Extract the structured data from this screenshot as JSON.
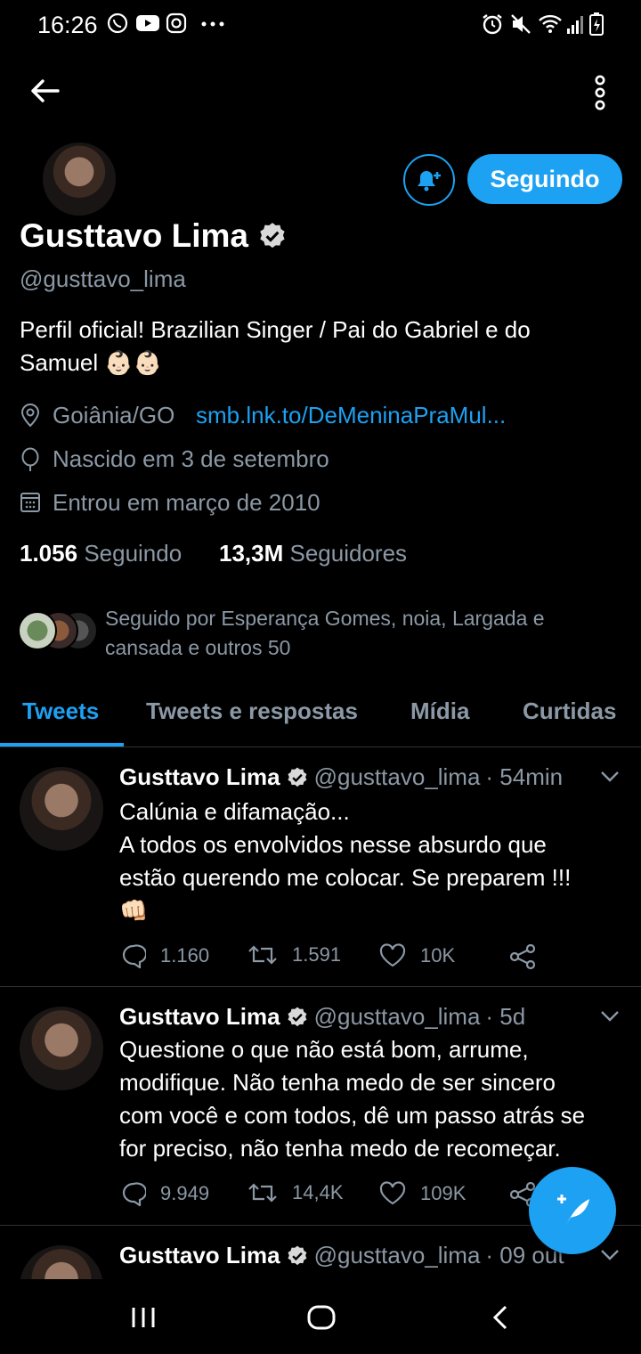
{
  "status_bar": {
    "time": "16:26",
    "left_icons": [
      "whatsapp-icon",
      "youtube-icon",
      "instagram-icon",
      "more-dots-icon"
    ],
    "right_icons": [
      "alarm-icon",
      "mute-icon",
      "wifi-icon",
      "signal-icon",
      "battery-icon"
    ]
  },
  "header": {
    "back_icon": "arrow-left-icon",
    "menu_icon": "kebab-icon"
  },
  "profile": {
    "name": "Gusttavo Lima",
    "handle": "@gusttavo_lima",
    "bio_line1": "Perfil oficial! Brazilian Singer / Pai do Gabriel e do",
    "bio_line2": "Samuel",
    "bio_emoji": "👶🏻👶🏻",
    "location": "Goiânia/GO",
    "link": "smb.lnk.to/DeMeninaPraMul...",
    "birthday": "Nascido em 3 de setembro",
    "joined": "Entrou em março de 2010",
    "following_count": "1.056",
    "following_label": "Seguindo",
    "followers_count": "13,3M",
    "followers_label": "Seguidores",
    "followed_by_line1": "Seguido por Esperança Gomes, noia, Largada e",
    "followed_by_line2": "cansada e outros 50",
    "follow_button": "Seguindo",
    "accent_color": "#1da1f2"
  },
  "tabs": [
    {
      "label": "Tweets",
      "active": true
    },
    {
      "label": "Tweets e respostas",
      "active": false
    },
    {
      "label": "Mídia",
      "active": false
    },
    {
      "label": "Curtidas",
      "active": false
    }
  ],
  "tweets": [
    {
      "name": "Gusttavo Lima",
      "handle": "@gusttavo_lima",
      "time": "· 54min",
      "lines": [
        "Calúnia e difamação...",
        "A todos os envolvidos nesse absurdo que",
        "estão querendo me colocar. Se preparem !!!"
      ],
      "emoji": "👊🏻",
      "replies": "1.160",
      "retweets": "1.591",
      "likes": "10K"
    },
    {
      "name": "Gusttavo Lima",
      "handle": "@gusttavo_lima",
      "time": "· 5d",
      "lines": [
        "Questione o que não está bom, arrume,",
        "modifique. Não tenha medo de ser sincero",
        "com você e com todos, dê um passo atrás se",
        "for preciso, não tenha medo de recomeçar."
      ],
      "replies": "9.949",
      "retweets": "14,4K",
      "likes": "109K"
    },
    {
      "name": "Gusttavo Lima",
      "handle": "@gusttavo_lima",
      "time": "· 09 out"
    }
  ],
  "fab_icon": "compose-tweet-icon",
  "nav_bar": {
    "icons": [
      "recents-icon",
      "home-icon",
      "back-icon"
    ]
  }
}
